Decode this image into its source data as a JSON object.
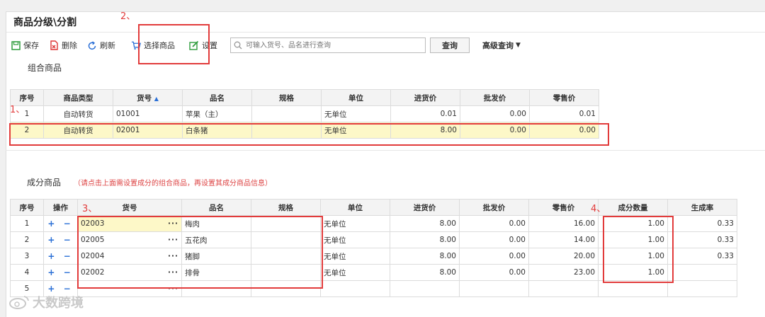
{
  "window": {
    "title": "商品分级\\分割"
  },
  "toolbar": {
    "save": "保存",
    "delete": "删除",
    "refresh": "刷新",
    "select_goods": "选择商品",
    "settings": "设置",
    "search_placeholder": "可输入货号、品名进行查询",
    "query": "查询",
    "advanced": "高级查询"
  },
  "combo": {
    "title": "组合商品",
    "headers": [
      "序号",
      "商品类型",
      "货号",
      "品名",
      "规格",
      "单位",
      "进货价",
      "批发价",
      "零售价"
    ],
    "sort_indicator": "▲",
    "rows": [
      {
        "idx": "1",
        "type": "自动转货",
        "code": "01001",
        "name": "苹果（主）",
        "spec": "",
        "unit": "无单位",
        "buy": "0.01",
        "wholesale": "0.00",
        "retail": "0.01"
      },
      {
        "idx": "2",
        "type": "自动转货",
        "code": "02001",
        "name": "白条猪",
        "spec": "",
        "unit": "无单位",
        "buy": "8.00",
        "wholesale": "0.00",
        "retail": "0.00"
      }
    ]
  },
  "component": {
    "title": "成分商品",
    "hint": "（请点击上面需设置成分的组合商品，再设置其成分商品信息）",
    "headers": [
      "序号",
      "操作",
      "货号",
      "品名",
      "规格",
      "单位",
      "进货价",
      "批发价",
      "零售价",
      "成分数量",
      "生成率"
    ],
    "ops": "+ −",
    "dots": "···",
    "rows": [
      {
        "idx": "1",
        "code": "02003",
        "name": "梅肉",
        "spec": "",
        "unit": "无单位",
        "buy": "8.00",
        "wholesale": "0.00",
        "retail": "16.00",
        "qty": "1.00",
        "rate": "0.33"
      },
      {
        "idx": "2",
        "code": "02005",
        "name": "五花肉",
        "spec": "",
        "unit": "无单位",
        "buy": "8.00",
        "wholesale": "0.00",
        "retail": "14.00",
        "qty": "1.00",
        "rate": "0.33"
      },
      {
        "idx": "3",
        "code": "02004",
        "name": "猪脚",
        "spec": "",
        "unit": "无单位",
        "buy": "8.00",
        "wholesale": "0.00",
        "retail": "20.00",
        "qty": "1.00",
        "rate": "0.33"
      },
      {
        "idx": "4",
        "code": "02002",
        "name": "排骨",
        "spec": "",
        "unit": "无单位",
        "buy": "8.00",
        "wholesale": "0.00",
        "retail": "23.00",
        "qty": "1.00",
        "rate": ""
      },
      {
        "idx": "5",
        "code": "",
        "name": "",
        "spec": "",
        "unit": "",
        "buy": "",
        "wholesale": "",
        "retail": "",
        "qty": "",
        "rate": ""
      }
    ]
  },
  "annotations": {
    "a1": "1、",
    "a2": "2、",
    "a3": "3、",
    "a4": "4、"
  },
  "watermark": "大数跨境",
  "colors": {
    "annotation_red": "#e23b3b",
    "selected_row": "#fdf8c8",
    "icon_blue": "#2a6fd6",
    "icon_green": "#2e9c3c"
  }
}
